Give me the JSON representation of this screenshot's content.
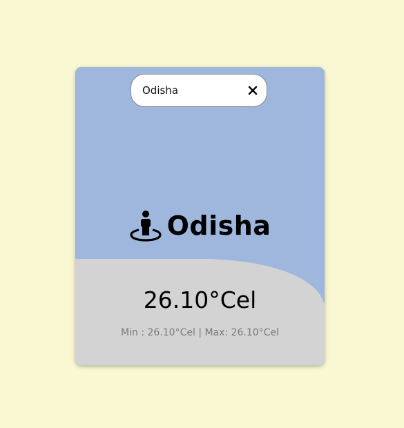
{
  "search": {
    "value": "Odisha",
    "clear_icon": "close-icon"
  },
  "location": {
    "icon": "person-pin-icon",
    "city": "Odisha"
  },
  "weather": {
    "temperature": "26.10°Cel",
    "minmax": "Min : 26.10°Cel | Max: 26.10°Cel"
  },
  "colors": {
    "page_background": "#f9f8d2",
    "card_background": "#9fb6dd",
    "bottom_panel": "#d3d3d3"
  }
}
